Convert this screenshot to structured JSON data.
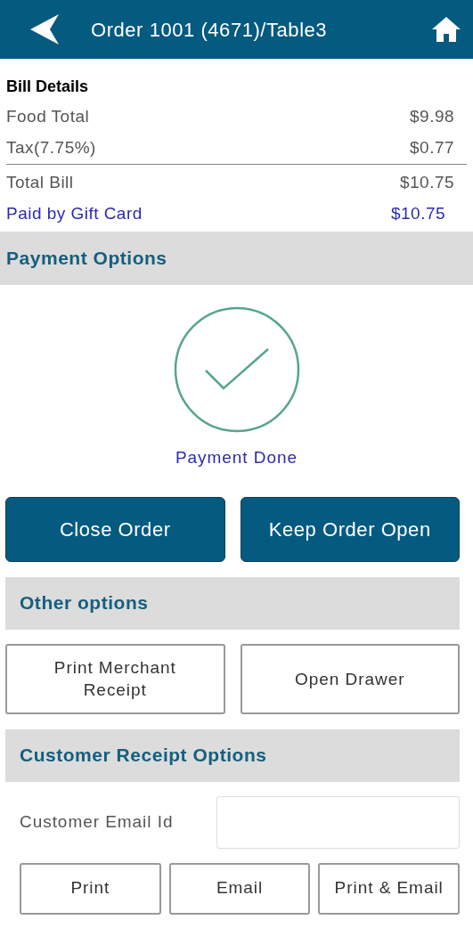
{
  "header": {
    "title": "Order 1001 (4671)/Table3"
  },
  "bill_details": {
    "title": "Bill Details",
    "rows": [
      {
        "label": "Food Total",
        "value": "$9.98",
        "kind": "plain"
      },
      {
        "label": "Tax(7.75%)",
        "value": "$0.77",
        "kind": "plain"
      },
      {
        "label": "Total Bill",
        "value": "$10.75",
        "kind": "total"
      },
      {
        "label": "Paid by Gift Card",
        "value": "$10.75",
        "kind": "paid"
      }
    ]
  },
  "payment_options": {
    "title": "Payment Options",
    "status": "Payment Done",
    "buttons": [
      "Close Order",
      "Keep Order Open"
    ]
  },
  "other_options": {
    "title": "Other options",
    "buttons": [
      "Print Merchant Receipt",
      "Open Drawer"
    ]
  },
  "customer_receipt_options": {
    "title": "Customer Receipt Options",
    "email_label": "Customer Email Id",
    "buttons": [
      "Print",
      "Email",
      "Print & Email"
    ]
  }
}
